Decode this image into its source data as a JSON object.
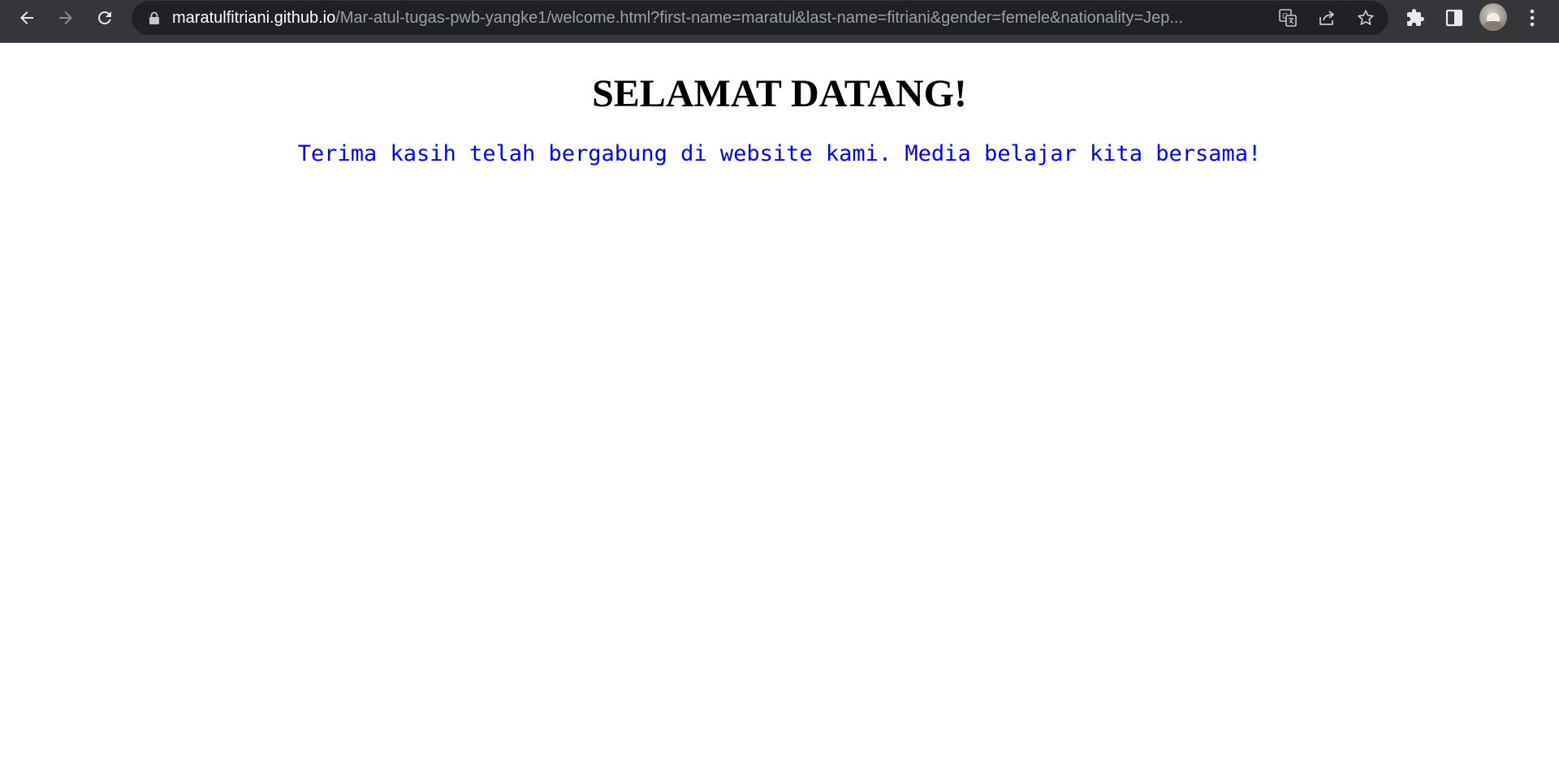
{
  "browser": {
    "url_host": "maratulfitriani.github.io",
    "url_path": "/Mar-atul-tugas-pwb-yangke1/welcome.html?first-name=maratul&last-name=fitriani&gender=femele&nationality=Jep...",
    "icons": {
      "back": "arrow-left-icon",
      "forward": "arrow-right-icon",
      "reload": "reload-icon",
      "lock": "lock-icon",
      "translate": "translate-icon",
      "share": "share-icon",
      "bookmark": "star-icon",
      "extensions": "puzzle-icon",
      "side_panel": "side-panel-icon",
      "menu": "kebab-menu-icon"
    },
    "colors": {
      "toolbar_bg": "#35363a",
      "omnibox_bg": "#202124",
      "url_host": "#ffffff",
      "url_path": "#9aa0a6"
    }
  },
  "page": {
    "title": "SELAMAT DATANG!",
    "message": "Terima kasih telah bergabung di website kami. Media belajar kita bersama!",
    "colors": {
      "title": "#000000",
      "message": "#0000ff",
      "background": "#ffffff"
    }
  }
}
